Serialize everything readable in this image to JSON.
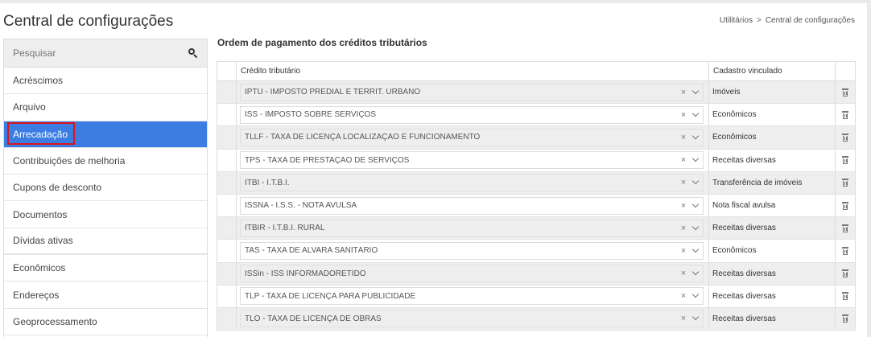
{
  "header": {
    "title": "Central de configurações",
    "breadcrumb": [
      "Utilitários",
      "Central de configurações"
    ],
    "breadcrumb_separator": ">"
  },
  "sidebar": {
    "search_placeholder": "Pesquisar",
    "items": [
      {
        "label": "Acréscimos"
      },
      {
        "label": "Arquivo"
      },
      {
        "label": "Arrecadação",
        "active": true
      },
      {
        "label": "Contribuições de melhoria"
      },
      {
        "label": "Cupons de desconto"
      },
      {
        "label": "Documentos"
      },
      {
        "label": "Dívidas ativas"
      },
      {
        "label": "Econômicos"
      },
      {
        "label": "Endereços"
      },
      {
        "label": "Geoprocessamento"
      }
    ]
  },
  "main": {
    "section_title": "Ordem de pagamento dos créditos tributários",
    "columns": [
      "Crédito tributário",
      "Cadastro vinculado"
    ],
    "rows": [
      {
        "credito": "IPTU - IMPOSTO PREDIAL E TERRIT. URBANO",
        "cadastro": "Imóveis"
      },
      {
        "credito": "ISS - IMPOSTO SOBRE SERVIÇOS",
        "cadastro": "Econômicos"
      },
      {
        "credito": "TLLF - TAXA DE LICENÇA LOCALIZAÇÃO E FUNCIONAMENTO",
        "cadastro": "Econômicos"
      },
      {
        "credito": "TPS - TAXA DE PRESTAÇÃO DE SERVIÇOS",
        "cadastro": "Receitas diversas"
      },
      {
        "credito": "ITBI - I.T.B.I.",
        "cadastro": "Transferência de imóveis"
      },
      {
        "credito": "ISSNA - I.S.S. - NOTA AVULSA",
        "cadastro": "Nota fiscal avulsa"
      },
      {
        "credito": "ITBIR - I.T.B.I. RURAL",
        "cadastro": "Receitas diversas"
      },
      {
        "credito": "TAS - TAXA DE ALVARA SANITÁRIO",
        "cadastro": "Econômicos"
      },
      {
        "credito": "ISSin - ISS INFORMADORETIDO",
        "cadastro": "Receitas diversas"
      },
      {
        "credito": "TLP - TAXA DE LICENÇA PARA PUBLICIDADE",
        "cadastro": "Receitas diversas"
      },
      {
        "credito": "TLO - TAXA DE LICENÇA DE OBRAS",
        "cadastro": "Receitas diversas"
      }
    ],
    "clear_glyph": "×"
  },
  "colors": {
    "active_item": "#3b7de2",
    "highlight_border": "#d9151b"
  }
}
